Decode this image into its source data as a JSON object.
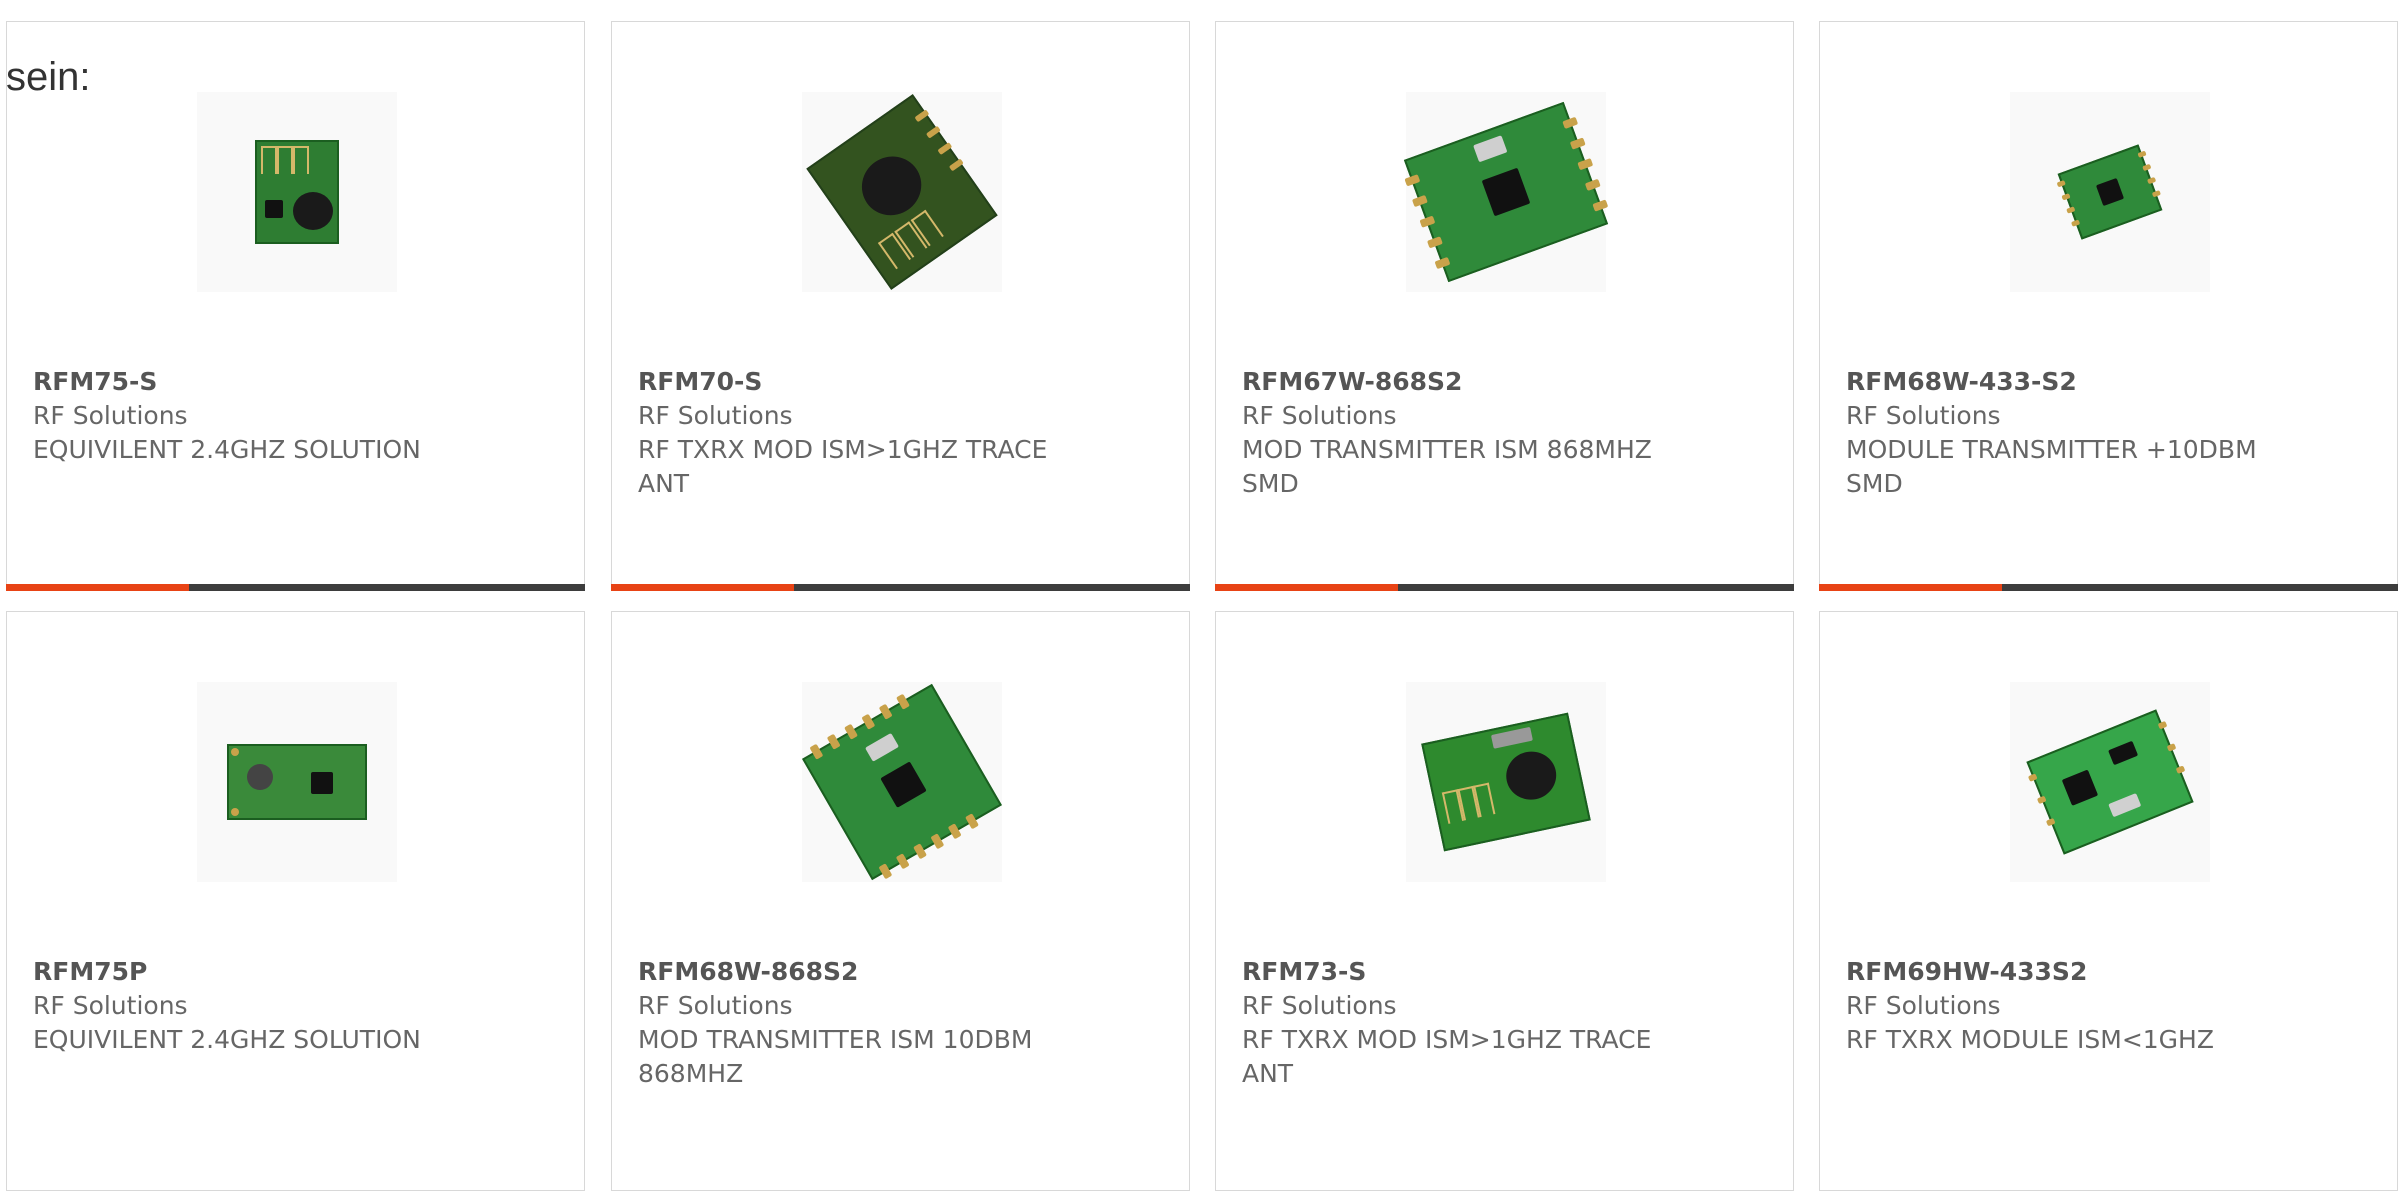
{
  "heading": "sein:",
  "colors": {
    "accent": "#e84315",
    "bar": "#3d3d3d",
    "text": "#666666"
  },
  "products": [
    {
      "pn": "RFM75-S",
      "mfr": "RF Solutions",
      "desc": "EQUIVILENT 2.4GHZ SOLUTION",
      "image_icon": "rf-module-small-icon"
    },
    {
      "pn": "RFM70-S",
      "mfr": "RF Solutions",
      "desc": "RF TXRX MOD ISM>1GHZ TRACE ANT",
      "image_icon": "rf-module-trace-antenna-icon"
    },
    {
      "pn": "RFM67W-868S2",
      "mfr": "RF Solutions",
      "desc": "MOD TRANSMITTER ISM 868MHZ SMD",
      "image_icon": "rf-module-smd-icon"
    },
    {
      "pn": "RFM68W-433-S2",
      "mfr": "RF Solutions",
      "desc": "MODULE TRANSMITTER +10DBM SMD",
      "image_icon": "rf-module-smd-small-icon"
    },
    {
      "pn": "RFM75P",
      "mfr": "RF Solutions",
      "desc": "EQUIVILENT 2.4GHZ SOLUTION",
      "image_icon": "rf-module-pcb-icon"
    },
    {
      "pn": "RFM68W-868S2",
      "mfr": "RF Solutions",
      "desc": "MOD TRANSMITTER ISM 10DBM 868MHZ",
      "image_icon": "rf-module-smd-icon"
    },
    {
      "pn": "RFM73-S",
      "mfr": "RF Solutions",
      "desc": "RF TXRX MOD ISM>1GHZ TRACE ANT",
      "image_icon": "rf-module-trace-antenna-icon"
    },
    {
      "pn": "RFM69HW-433S2",
      "mfr": "RF Solutions",
      "desc": "RF TXRX MODULE ISM<1GHZ",
      "image_icon": "rf-module-smd-icon"
    }
  ]
}
